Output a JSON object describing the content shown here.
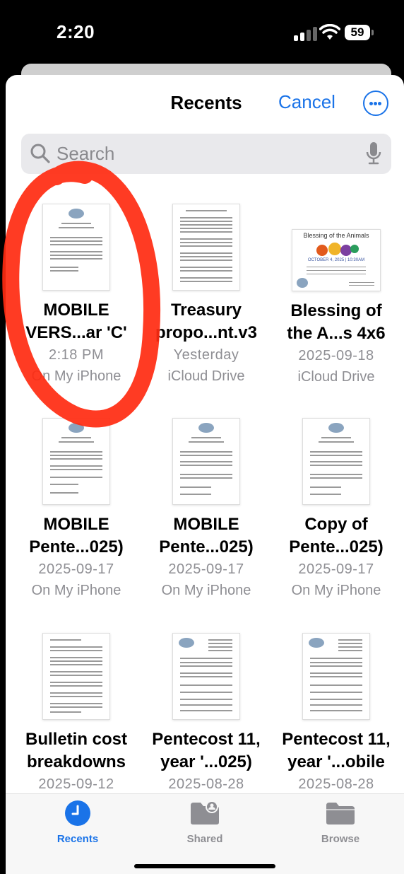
{
  "status": {
    "time": "2:20",
    "battery": "59"
  },
  "nav": {
    "title": "Recents",
    "cancel": "Cancel"
  },
  "search": {
    "placeholder": "Search"
  },
  "files": [
    {
      "name1": "MOBILE",
      "name2": "VERS...ar 'C'",
      "date": "2:18 PM",
      "location": "On My iPhone"
    },
    {
      "name1": "Treasury",
      "name2": "propo...nt.v3",
      "date": "Yesterday",
      "location": "iCloud Drive"
    },
    {
      "name1": "Blessing of",
      "name2": "the A...s 4x6",
      "date": "2025-09-18",
      "location": "iCloud Drive",
      "preview_title": "Blessing of the Animals",
      "preview_date": "OCTOBER 4, 2025 | 10:30AM"
    },
    {
      "name1": "MOBILE",
      "name2": "Pente...025)",
      "date": "2025-09-17",
      "location": "On My iPhone"
    },
    {
      "name1": "MOBILE",
      "name2": "Pente...025)",
      "date": "2025-09-17",
      "location": "On My iPhone"
    },
    {
      "name1": "Copy of",
      "name2": "Pente...025)",
      "date": "2025-09-17",
      "location": "On My iPhone"
    },
    {
      "name1": "Bulletin cost",
      "name2": "breakdowns",
      "date": "2025-09-12",
      "location": ""
    },
    {
      "name1": "Pentecost 11,",
      "name2": "year '...025)",
      "date": "2025-08-28",
      "location": ""
    },
    {
      "name1": "Pentecost 11,",
      "name2": "year '...obile",
      "date": "2025-08-28",
      "location": ""
    }
  ],
  "tabs": [
    {
      "label": "Recents",
      "icon": "clock-icon",
      "active": true
    },
    {
      "label": "Shared",
      "icon": "shared-folder-icon",
      "active": false
    },
    {
      "label": "Browse",
      "icon": "folder-icon",
      "active": false
    }
  ],
  "colors": {
    "accent": "#1a73e8",
    "annotation": "#ff2a10",
    "secondary_text": "#8e8e93"
  }
}
